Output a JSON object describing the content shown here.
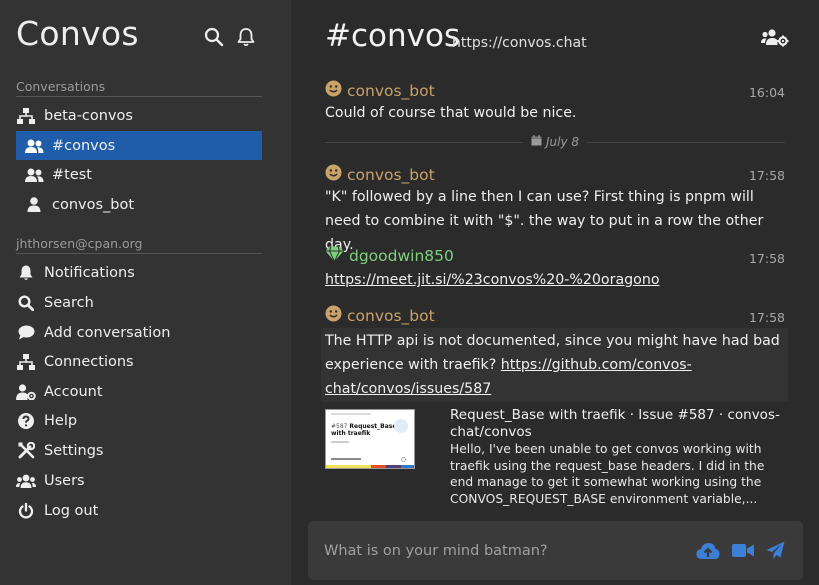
{
  "app": {
    "title": "Convos"
  },
  "sidebar": {
    "conversations_title": "Conversations",
    "conversations": [
      {
        "label": "beta-convos",
        "icon": "network-icon"
      },
      {
        "label": "#convos",
        "icon": "users-icon",
        "active": true
      },
      {
        "label": "#test",
        "icon": "users-icon"
      },
      {
        "label": "convos_bot",
        "icon": "user-icon"
      }
    ],
    "account_title": "jhthorsen@cpan.org",
    "menu": [
      {
        "label": "Notifications",
        "icon": "bell-icon"
      },
      {
        "label": "Search",
        "icon": "search-icon"
      },
      {
        "label": "Add conversation",
        "icon": "comment-icon"
      },
      {
        "label": "Connections",
        "icon": "network-icon"
      },
      {
        "label": "Account",
        "icon": "user-cog-icon"
      },
      {
        "label": "Help",
        "icon": "question-icon"
      },
      {
        "label": "Settings",
        "icon": "tools-icon"
      },
      {
        "label": "Users",
        "icon": "users-icon"
      },
      {
        "label": "Log out",
        "icon": "power-icon"
      }
    ]
  },
  "header": {
    "channel": "#convos",
    "topic": "https://convos.chat"
  },
  "messages": [
    {
      "nick": "convos_bot",
      "time": "16:04",
      "text": "Could of course that would be nice."
    },
    {
      "nick": "convos_bot",
      "time": "17:58",
      "text": "\"K\" followed by a line then I can use? First thing is pnpm will need to combine it with \"$\". the way to put in a row the other day."
    },
    {
      "nick": "dgoodwin850",
      "time": "17:58",
      "link": "https://meet.jit.si/%23convos%20-%20oragono"
    },
    {
      "nick": "convos_bot",
      "time": "17:58",
      "text_before": "The HTTP api is not documented, since you might have had bad experience with traefik? ",
      "link": "https://github.com/convos-chat/convos/issues/587"
    }
  ],
  "date_separator": "July 8",
  "preview": {
    "title": "Request_Base with traefik · Issue #587 · convos-chat/convos",
    "description": "Hello, I've been unable to get convos working with traefik using the request_base headers. I did in the end manage to get it somewhat working using the CONVOS_REQUEST_BASE environment variable,...",
    "thumb_issue": "#587",
    "thumb_heading": "Request_Base with traefik"
  },
  "composer": {
    "placeholder": "What is on your mind batman?"
  },
  "colors": {
    "accent": "#1f5ca9",
    "icon_blue": "#3c7fd6",
    "bot_nick": "#c9a26a",
    "user_nick": "#7ed07e"
  }
}
